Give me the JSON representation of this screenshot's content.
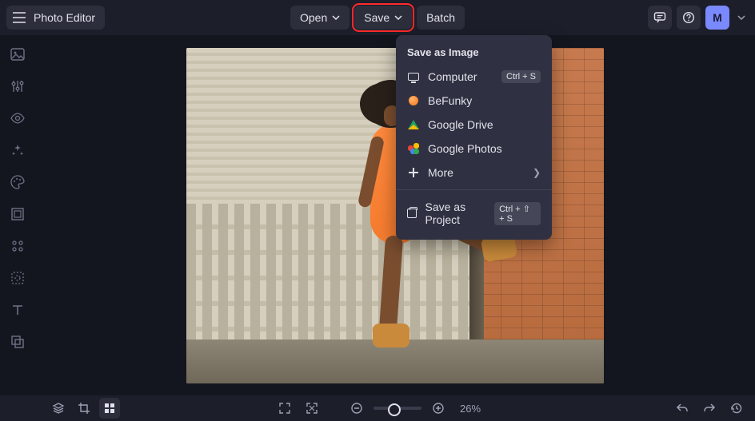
{
  "header": {
    "app_title": "Photo Editor",
    "open_label": "Open",
    "save_label": "Save",
    "batch_label": "Batch",
    "avatar_letter": "M"
  },
  "save_menu": {
    "header": "Save as Image",
    "computer": "Computer",
    "computer_kbd": "Ctrl + S",
    "befunky": "BeFunky",
    "drive": "Google Drive",
    "photos": "Google Photos",
    "more": "More",
    "project": "Save as Project",
    "project_kbd": "Ctrl + ⇧ + S"
  },
  "bottom": {
    "zoom": "26%"
  },
  "rail_icons": [
    "image",
    "sliders",
    "eye",
    "sparkle",
    "palette",
    "frame",
    "grid",
    "crop",
    "text",
    "layers"
  ],
  "colors": {
    "befunky": "#ff7418",
    "photos": {
      "a": "#f9bc15",
      "b": "#ea4335",
      "c": "#4285f4",
      "d": "#34a853"
    }
  }
}
